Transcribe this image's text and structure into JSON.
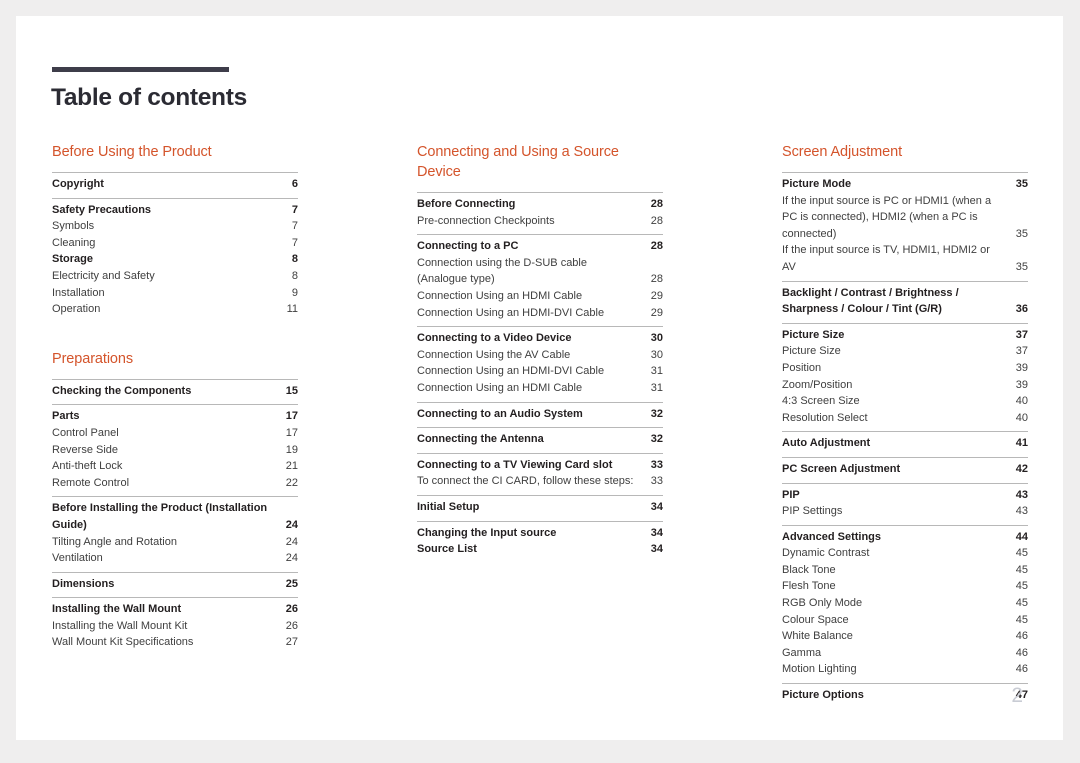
{
  "document": {
    "title": "Table of contents",
    "page_number": "2",
    "accent_color": "#d4542b",
    "rule_color": "#b8b8b8",
    "title_bar_color": "#3e3d4a"
  },
  "columns": [
    {
      "name": "column-1",
      "sections": [
        {
          "title": "Before Using the Product",
          "groups": [
            {
              "entries": [
                {
                  "label": "Copyright",
                  "page": "6",
                  "level": "head"
                }
              ]
            },
            {
              "entries": [
                {
                  "label": "Safety Precautions",
                  "page": "7",
                  "level": "head"
                },
                {
                  "label": "Symbols",
                  "page": "7",
                  "level": "sub"
                },
                {
                  "label": "Cleaning",
                  "page": "7",
                  "level": "sub"
                },
                {
                  "label": "Storage",
                  "page": "8",
                  "level": "head"
                },
                {
                  "label": "Electricity and Safety",
                  "page": "8",
                  "level": "sub"
                },
                {
                  "label": "Installation",
                  "page": "9",
                  "level": "sub"
                },
                {
                  "label": "Operation",
                  "page": "11",
                  "level": "sub"
                }
              ]
            }
          ]
        },
        {
          "title": "Preparations",
          "groups": [
            {
              "entries": [
                {
                  "label": "Checking the Components",
                  "page": "15",
                  "level": "head"
                }
              ]
            },
            {
              "entries": [
                {
                  "label": "Parts",
                  "page": "17",
                  "level": "head"
                },
                {
                  "label": "Control Panel",
                  "page": "17",
                  "level": "sub"
                },
                {
                  "label": "Reverse Side",
                  "page": "19",
                  "level": "sub"
                },
                {
                  "label": "Anti-theft Lock",
                  "page": "21",
                  "level": "sub"
                },
                {
                  "label": "Remote Control",
                  "page": "22",
                  "level": "sub"
                }
              ]
            },
            {
              "entries": [
                {
                  "label": "Before Installing the Product (Installation Guide)",
                  "page": "24",
                  "level": "head"
                },
                {
                  "label": "Tilting Angle and Rotation",
                  "page": "24",
                  "level": "sub"
                },
                {
                  "label": "Ventilation",
                  "page": "24",
                  "level": "sub"
                }
              ]
            },
            {
              "entries": [
                {
                  "label": "Dimensions",
                  "page": "25",
                  "level": "head"
                }
              ]
            },
            {
              "entries": [
                {
                  "label": "Installing the Wall Mount",
                  "page": "26",
                  "level": "head"
                },
                {
                  "label": "Installing the Wall Mount Kit",
                  "page": "26",
                  "level": "sub"
                },
                {
                  "label": "Wall Mount Kit Specifications",
                  "page": "27",
                  "level": "sub"
                }
              ]
            }
          ]
        }
      ]
    },
    {
      "name": "column-2",
      "sections": [
        {
          "title": "Connecting and Using a Source Device",
          "groups": [
            {
              "entries": [
                {
                  "label": "Before Connecting",
                  "page": "28",
                  "level": "head"
                },
                {
                  "label": "Pre-connection Checkpoints",
                  "page": "28",
                  "level": "sub"
                }
              ]
            },
            {
              "entries": [
                {
                  "label": "Connecting to a PC",
                  "page": "28",
                  "level": "head"
                },
                {
                  "label": "Connection using the D-SUB cable (Analogue type)",
                  "page": "28",
                  "level": "sub"
                },
                {
                  "label": "Connection Using an HDMI Cable",
                  "page": "29",
                  "level": "sub"
                },
                {
                  "label": "Connection Using an HDMI-DVI Cable",
                  "page": "29",
                  "level": "sub"
                }
              ]
            },
            {
              "entries": [
                {
                  "label": "Connecting to a Video Device",
                  "page": "30",
                  "level": "head"
                },
                {
                  "label": "Connection Using the AV Cable",
                  "page": "30",
                  "level": "sub"
                },
                {
                  "label": "Connection Using an HDMI-DVI Cable",
                  "page": "31",
                  "level": "sub"
                },
                {
                  "label": "Connection Using an HDMI Cable",
                  "page": "31",
                  "level": "sub"
                }
              ]
            },
            {
              "entries": [
                {
                  "label": "Connecting to an Audio System",
                  "page": "32",
                  "level": "head"
                }
              ]
            },
            {
              "entries": [
                {
                  "label": "Connecting the Antenna",
                  "page": "32",
                  "level": "head"
                }
              ]
            },
            {
              "entries": [
                {
                  "label": "Connecting to a TV Viewing Card slot",
                  "page": "33",
                  "level": "head"
                },
                {
                  "label": "To connect the CI CARD, follow these steps:",
                  "page": "33",
                  "level": "sub"
                }
              ]
            },
            {
              "entries": [
                {
                  "label": "Initial Setup",
                  "page": "34",
                  "level": "head"
                }
              ]
            },
            {
              "entries": [
                {
                  "label": "Changing the Input source",
                  "page": "34",
                  "level": "head"
                },
                {
                  "label": "Source List",
                  "page": "34",
                  "level": "head"
                }
              ]
            }
          ]
        }
      ]
    },
    {
      "name": "column-3",
      "sections": [
        {
          "title": "Screen Adjustment",
          "groups": [
            {
              "entries": [
                {
                  "label": "Picture Mode",
                  "page": "35",
                  "level": "head"
                },
                {
                  "label": "If the input source is PC or HDMI1 (when a PC is connected), HDMI2 (when a PC is connected)",
                  "page": "35",
                  "level": "sub"
                },
                {
                  "label": "If the input source is TV, HDMI1, HDMI2 or AV",
                  "page": "35",
                  "level": "sub"
                }
              ]
            },
            {
              "entries": [
                {
                  "label": "Backlight / Contrast / Brightness / Sharpness / Colour / Tint (G/R)",
                  "page": "36",
                  "level": "head"
                }
              ]
            },
            {
              "entries": [
                {
                  "label": "Picture Size",
                  "page": "37",
                  "level": "head"
                },
                {
                  "label": "Picture Size",
                  "page": "37",
                  "level": "sub"
                },
                {
                  "label": "Position",
                  "page": "39",
                  "level": "sub"
                },
                {
                  "label": "Zoom/Position",
                  "page": "39",
                  "level": "sub"
                },
                {
                  "label": "4:3 Screen Size",
                  "page": "40",
                  "level": "sub"
                },
                {
                  "label": "Resolution Select",
                  "page": "40",
                  "level": "sub"
                }
              ]
            },
            {
              "entries": [
                {
                  "label": "Auto Adjustment",
                  "page": "41",
                  "level": "head"
                }
              ]
            },
            {
              "entries": [
                {
                  "label": "PC Screen Adjustment",
                  "page": "42",
                  "level": "head"
                }
              ]
            },
            {
              "entries": [
                {
                  "label": "PIP",
                  "page": "43",
                  "level": "head"
                },
                {
                  "label": "PIP Settings",
                  "page": "43",
                  "level": "sub"
                }
              ]
            },
            {
              "entries": [
                {
                  "label": "Advanced Settings",
                  "page": "44",
                  "level": "head"
                },
                {
                  "label": "Dynamic Contrast",
                  "page": "45",
                  "level": "sub"
                },
                {
                  "label": "Black Tone",
                  "page": "45",
                  "level": "sub"
                },
                {
                  "label": "Flesh Tone",
                  "page": "45",
                  "level": "sub"
                },
                {
                  "label": "RGB Only Mode",
                  "page": "45",
                  "level": "sub"
                },
                {
                  "label": "Colour Space",
                  "page": "45",
                  "level": "sub"
                },
                {
                  "label": "White Balance",
                  "page": "46",
                  "level": "sub"
                },
                {
                  "label": "Gamma",
                  "page": "46",
                  "level": "sub"
                },
                {
                  "label": "Motion Lighting",
                  "page": "46",
                  "level": "sub"
                }
              ]
            },
            {
              "entries": [
                {
                  "label": "Picture Options",
                  "page": "47",
                  "level": "head"
                }
              ]
            }
          ]
        }
      ]
    }
  ]
}
